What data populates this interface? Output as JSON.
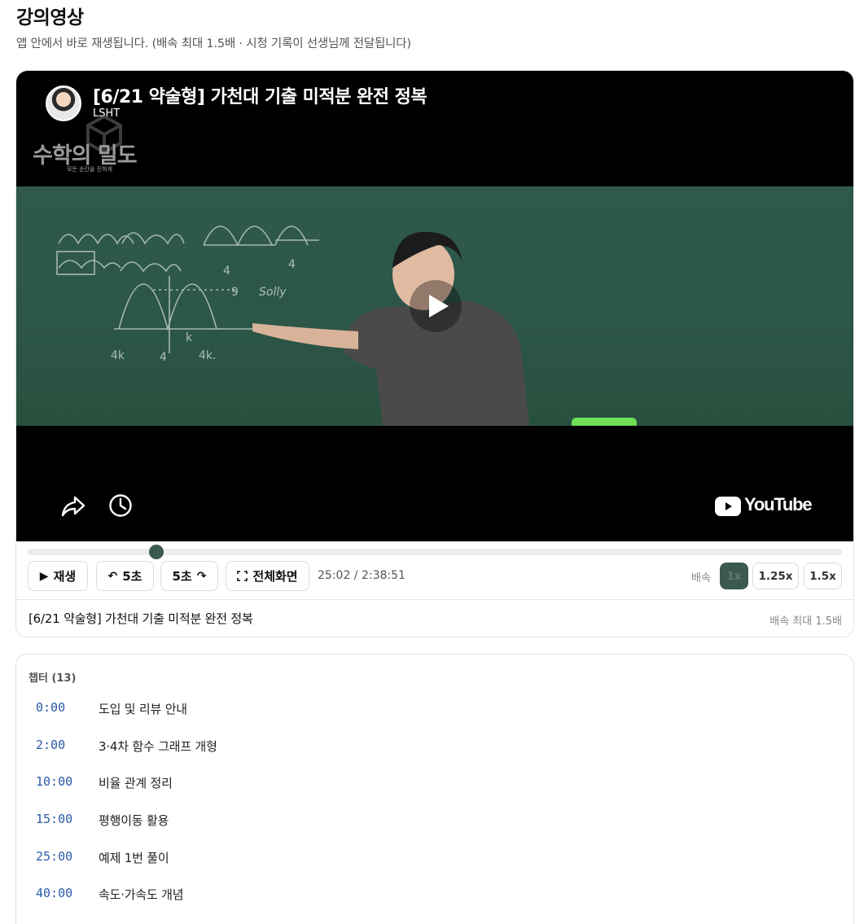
{
  "page": {
    "title": "강의영상",
    "subtitle": "앱 안에서 바로 재생됩니다. (배속 최대 1.5배 · 시청 기록이 선생님께 전달됩니다)"
  },
  "video": {
    "title": "[6/21 약술형] 가천대 기출 미적분 완전 정복",
    "channel": "LSHT",
    "overlay_logo": "수학의 밀도",
    "overlay_logo_sub": "모든 순간을 진하게",
    "youtube_wordmark": "YouTube"
  },
  "board_writing": {
    "n1": "9",
    "n2": "4",
    "n3": "4",
    "n4": "4",
    "note": "Solly",
    "m1": "4k",
    "m2": "4",
    "m3": "k",
    "m4": "4k."
  },
  "controls": {
    "play_label": "재생",
    "rewind_label": "5초",
    "forward_label": "5초",
    "fullscreen_label": "전체화면",
    "time_display": "25:02 / 2:38:51",
    "current_seconds": 1502,
    "duration_seconds": 9531,
    "speed_label": "배속",
    "speeds": [
      "1x",
      "1.25x",
      "1.5x"
    ],
    "selected_speed": "1x"
  },
  "footer": {
    "title": "[6/21 약술형] 가천대 기출 미적분 완전 정복",
    "note": "배속 최대 1.5배"
  },
  "chapters": {
    "heading": "챕터 (13)",
    "items": [
      {
        "time": "0:00",
        "label": "도입 및 리뷰 안내"
      },
      {
        "time": "2:00",
        "label": "3·4차 함수 그래프 개형"
      },
      {
        "time": "10:00",
        "label": "비율 관계 정리"
      },
      {
        "time": "15:00",
        "label": "평행이동 활용"
      },
      {
        "time": "25:00",
        "label": "예제 1번 풀이"
      },
      {
        "time": "40:00",
        "label": "속도·가속도 개념"
      }
    ]
  },
  "colors": {
    "accent": "#3b5a4d",
    "chalkboard": "#2f5a4b",
    "chapter_time": "#2a5aa8"
  }
}
